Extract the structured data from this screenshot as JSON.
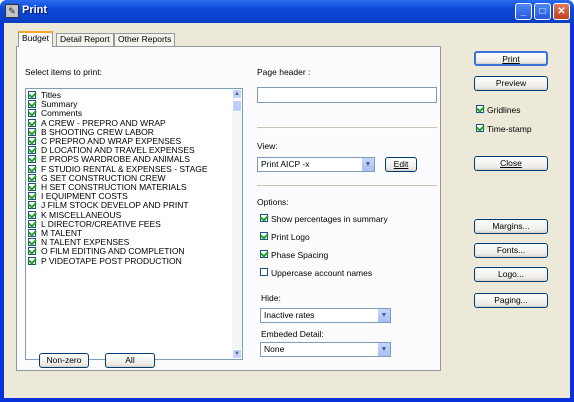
{
  "window": {
    "title": "Print"
  },
  "tabs": [
    {
      "label": "Budget"
    },
    {
      "label": "Detail Report"
    },
    {
      "label": "Other Reports"
    }
  ],
  "left": {
    "select_label": "Select items to print:",
    "items": [
      {
        "label": "Titles",
        "checked": true
      },
      {
        "label": "Summary",
        "checked": true
      },
      {
        "label": "Comments",
        "checked": true
      },
      {
        "label": "A  CREW - PREPRO AND WRAP",
        "checked": true
      },
      {
        "label": "B  SHOOTING CREW LABOR",
        "checked": true
      },
      {
        "label": "C  PREPRO AND WRAP EXPENSES",
        "checked": true
      },
      {
        "label": "D  LOCATION AND TRAVEL EXPENSES",
        "checked": true
      },
      {
        "label": "E  PROPS WARDROBE AND ANIMALS",
        "checked": true
      },
      {
        "label": "F  STUDIO RENTAL & EXPENSES  -  STAGE",
        "checked": true
      },
      {
        "label": "G  SET CONSTRUCTION CREW",
        "checked": true
      },
      {
        "label": "H  SET CONSTRUCTION MATERIALS",
        "checked": true
      },
      {
        "label": "I  EQUIPMENT COSTS",
        "checked": true
      },
      {
        "label": "J  FILM STOCK DEVELOP AND PRINT",
        "checked": true
      },
      {
        "label": "K  MISCELLANEOUS",
        "checked": true
      },
      {
        "label": "L  DIRECTOR/CREATIVE FEES",
        "checked": true
      },
      {
        "label": "M  TALENT",
        "checked": true
      },
      {
        "label": "N  TALENT EXPENSES",
        "checked": true
      },
      {
        "label": "O  FILM EDITING AND COMPLETION",
        "checked": true
      },
      {
        "label": "P  VIDEOTAPE POST PRODUCTION",
        "checked": true
      }
    ],
    "nonzero_button": "Non-zero",
    "all_button": "All"
  },
  "middle": {
    "page_header_label": "Page header :",
    "page_header_value": "",
    "view_label": "View:",
    "view_value": "Print AICP -x",
    "edit_button": "Edit",
    "options_label": "Options:",
    "options": [
      {
        "label": "Show percentages in summary",
        "checked": true
      },
      {
        "label": "Print Logo",
        "checked": true
      },
      {
        "label": "Phase Spacing",
        "checked": true
      },
      {
        "label": "Uppercase account names",
        "checked": false
      }
    ],
    "hide_label": "Hide:",
    "hide_value": "Inactive rates",
    "embeded_label": "Embeded Detail:",
    "embeded_value": "None"
  },
  "right": {
    "print_button": "Print",
    "preview_button": "Preview",
    "gridlines_label": "Gridlines",
    "gridlines_checked": true,
    "timestamp_label": "Time-stamp",
    "timestamp_checked": true,
    "close_button": "Close",
    "margins_button": "Margins...",
    "fonts_button": "Fonts...",
    "logo_button": "Logo...",
    "paging_button": "Paging..."
  }
}
